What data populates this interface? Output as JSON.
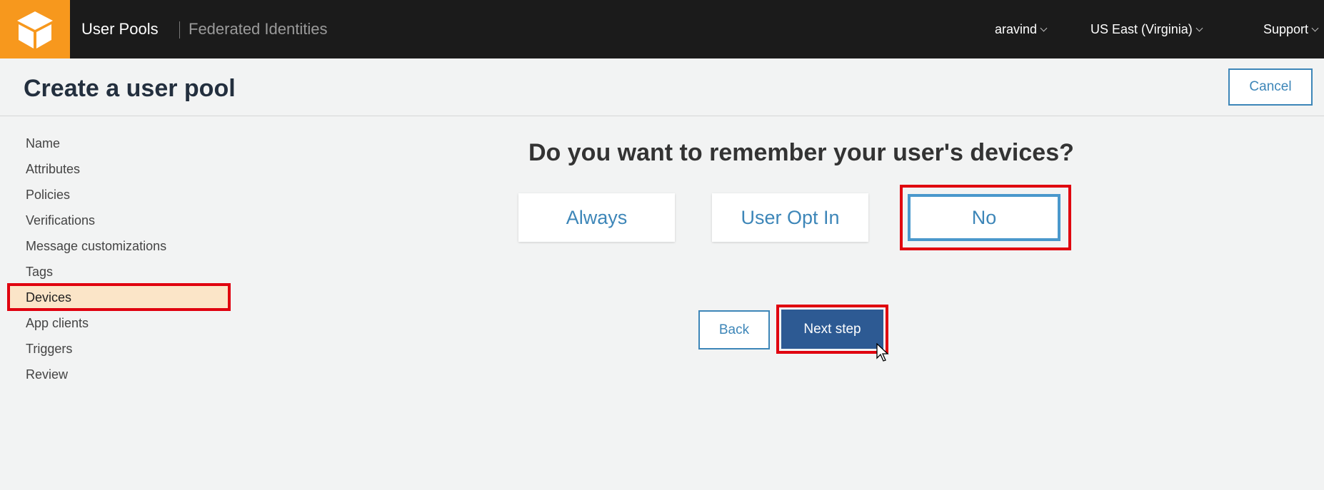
{
  "topbar": {
    "user_pools": "User Pools",
    "federated_identities": "Federated Identities",
    "user": "aravind",
    "region": "US East (Virginia)",
    "support": "Support",
    "logo_icon": "aws-cube-icon"
  },
  "header": {
    "title": "Create a user pool",
    "cancel_label": "Cancel"
  },
  "sidebar": {
    "items": [
      {
        "label": "Name"
      },
      {
        "label": "Attributes"
      },
      {
        "label": "Policies"
      },
      {
        "label": "Verifications"
      },
      {
        "label": "Message customizations"
      },
      {
        "label": "Tags"
      },
      {
        "label": "Devices",
        "active": true
      },
      {
        "label": "App clients"
      },
      {
        "label": "Triggers"
      },
      {
        "label": "Review"
      }
    ]
  },
  "main": {
    "question": "Do you want to remember your user's devices?",
    "options": [
      {
        "label": "Always"
      },
      {
        "label": "User Opt In"
      },
      {
        "label": "No",
        "selected": true
      }
    ],
    "back_label": "Back",
    "next_label": "Next step"
  },
  "colors": {
    "accent": "#3d86b8",
    "primary_button": "#2d5a93",
    "highlight_box": "#e0000e",
    "logo_bg": "#f7981d",
    "active_sidebar": "#fbe5c8"
  }
}
